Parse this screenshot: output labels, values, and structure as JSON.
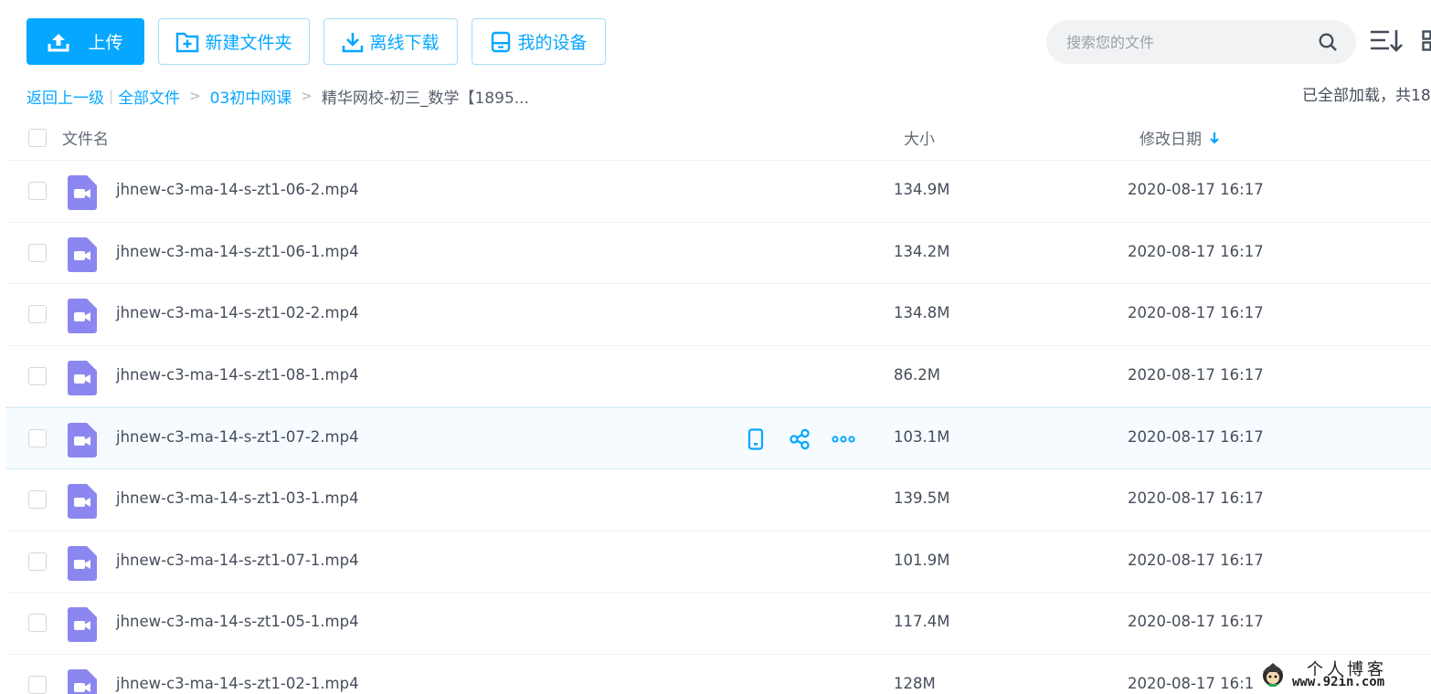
{
  "toolbar": {
    "upload_label": "上传",
    "new_folder_label": "新建文件夹",
    "offline_download_label": "离线下载",
    "my_devices_label": "我的设备"
  },
  "search": {
    "placeholder": "搜索您的文件"
  },
  "breadcrumb": {
    "back_label": "返回上一级",
    "root_label": "全部文件",
    "parent_label": "03初中网课",
    "current_label": "精华网校-初三_数学【1895..."
  },
  "load_status": "已全部加载，共18",
  "columns": {
    "name": "文件名",
    "size": "大小",
    "date": "修改日期"
  },
  "files": [
    {
      "name": "jhnew-c3-ma-14-s-zt1-06-2.mp4",
      "size": "134.9M",
      "date": "2020-08-17 16:17"
    },
    {
      "name": "jhnew-c3-ma-14-s-zt1-06-1.mp4",
      "size": "134.2M",
      "date": "2020-08-17 16:17"
    },
    {
      "name": "jhnew-c3-ma-14-s-zt1-02-2.mp4",
      "size": "134.8M",
      "date": "2020-08-17 16:17"
    },
    {
      "name": "jhnew-c3-ma-14-s-zt1-08-1.mp4",
      "size": "86.2M",
      "date": "2020-08-17 16:17"
    },
    {
      "name": "jhnew-c3-ma-14-s-zt1-07-2.mp4",
      "size": "103.1M",
      "date": "2020-08-17 16:17"
    },
    {
      "name": "jhnew-c3-ma-14-s-zt1-03-1.mp4",
      "size": "139.5M",
      "date": "2020-08-17 16:17"
    },
    {
      "name": "jhnew-c3-ma-14-s-zt1-07-1.mp4",
      "size": "101.9M",
      "date": "2020-08-17 16:17"
    },
    {
      "name": "jhnew-c3-ma-14-s-zt1-05-1.mp4",
      "size": "117.4M",
      "date": "2020-08-17 16:17"
    },
    {
      "name": "jhnew-c3-ma-14-s-zt1-02-1.mp4",
      "size": "128M",
      "date": "2020-08-17 16:1"
    }
  ],
  "hovered_row": 4,
  "watermark": {
    "title": "个人博客",
    "url": "www.92in.com"
  },
  "colors": {
    "accent": "#06a7ff",
    "video_icon": "#8b86f0",
    "text": "#454d5a"
  },
  "icons": {
    "upload": "upload-icon",
    "new_folder": "folder-plus-icon",
    "offline_download": "download-icon",
    "device": "device-icon",
    "search": "search-icon",
    "sort": "sort-icon",
    "grid": "grid-view-icon",
    "file": "video-file-icon",
    "row_actions": [
      "phone-icon",
      "share-icon",
      "more-icon"
    ]
  }
}
